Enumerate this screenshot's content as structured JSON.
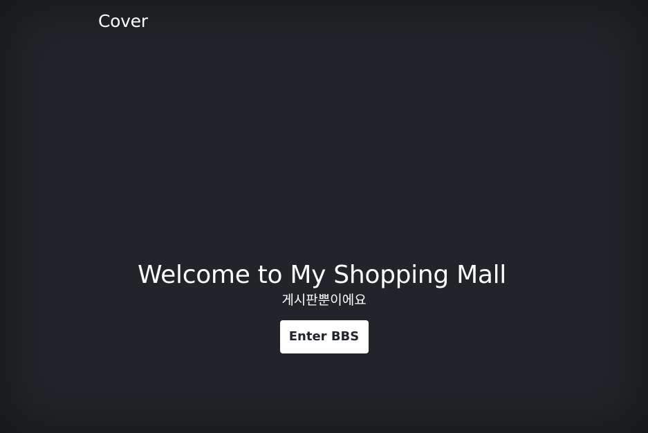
{
  "header": {
    "brand": "Cover"
  },
  "hero": {
    "title": "Welcome to My Shopping Mall",
    "lead": "게시판뿐이에요",
    "button_label": "Enter BBS"
  }
}
